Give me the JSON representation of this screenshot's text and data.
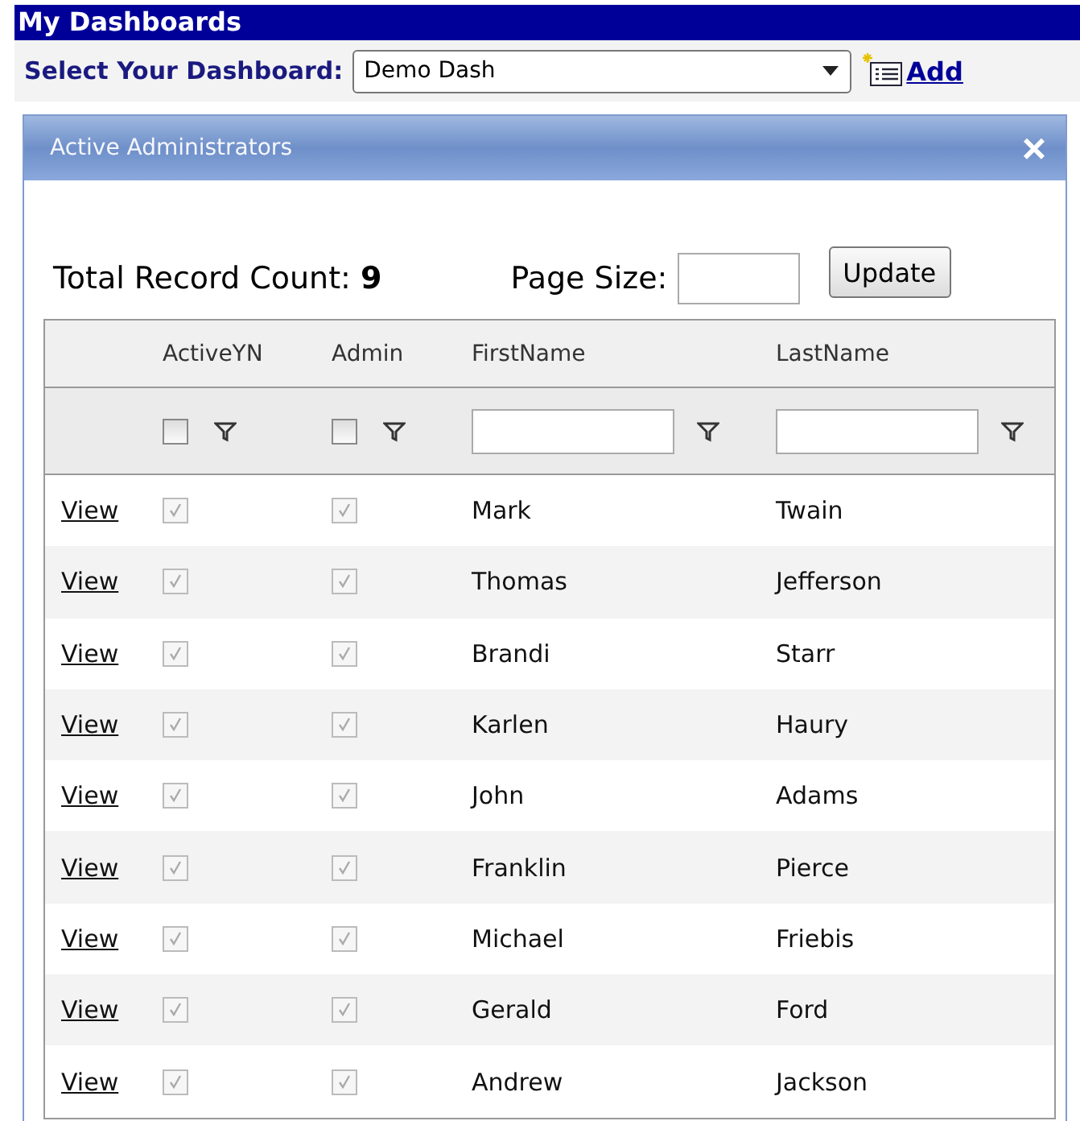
{
  "header": {
    "title": "My Dashboards"
  },
  "selector": {
    "label": "Select Your Dashboard:",
    "value": "Demo Dash",
    "add_link": "Add"
  },
  "panel": {
    "title": "Active Administrators",
    "close": "×"
  },
  "summary": {
    "count_label": "Total Record Count:",
    "count": "9",
    "page_size_label": "Page Size:",
    "update": "Update"
  },
  "table": {
    "columns": [
      "ActiveYN",
      "Admin",
      "FirstName",
      "LastName"
    ],
    "filters": {
      "active_checked": false,
      "admin_checked": false
    },
    "rows": [
      {
        "link": "View",
        "active": true,
        "admin": true,
        "first": "Mark",
        "last": "Twain"
      },
      {
        "link": "View",
        "active": true,
        "admin": true,
        "first": "Thomas",
        "last": "Jefferson"
      },
      {
        "link": "View",
        "active": true,
        "admin": true,
        "first": "Brandi",
        "last": "Starr"
      },
      {
        "link": "View",
        "active": true,
        "admin": true,
        "first": "Karlen",
        "last": "Haury"
      },
      {
        "link": "View",
        "active": true,
        "admin": true,
        "first": "John",
        "last": "Adams"
      },
      {
        "link": "View",
        "active": true,
        "admin": true,
        "first": "Franklin",
        "last": "Pierce"
      },
      {
        "link": "View",
        "active": true,
        "admin": true,
        "first": "Michael",
        "last": "Friebis"
      },
      {
        "link": "View",
        "active": true,
        "admin": true,
        "first": "Gerald",
        "last": "Ford"
      },
      {
        "link": "View",
        "active": true,
        "admin": true,
        "first": "Andrew",
        "last": "Jackson"
      }
    ]
  }
}
